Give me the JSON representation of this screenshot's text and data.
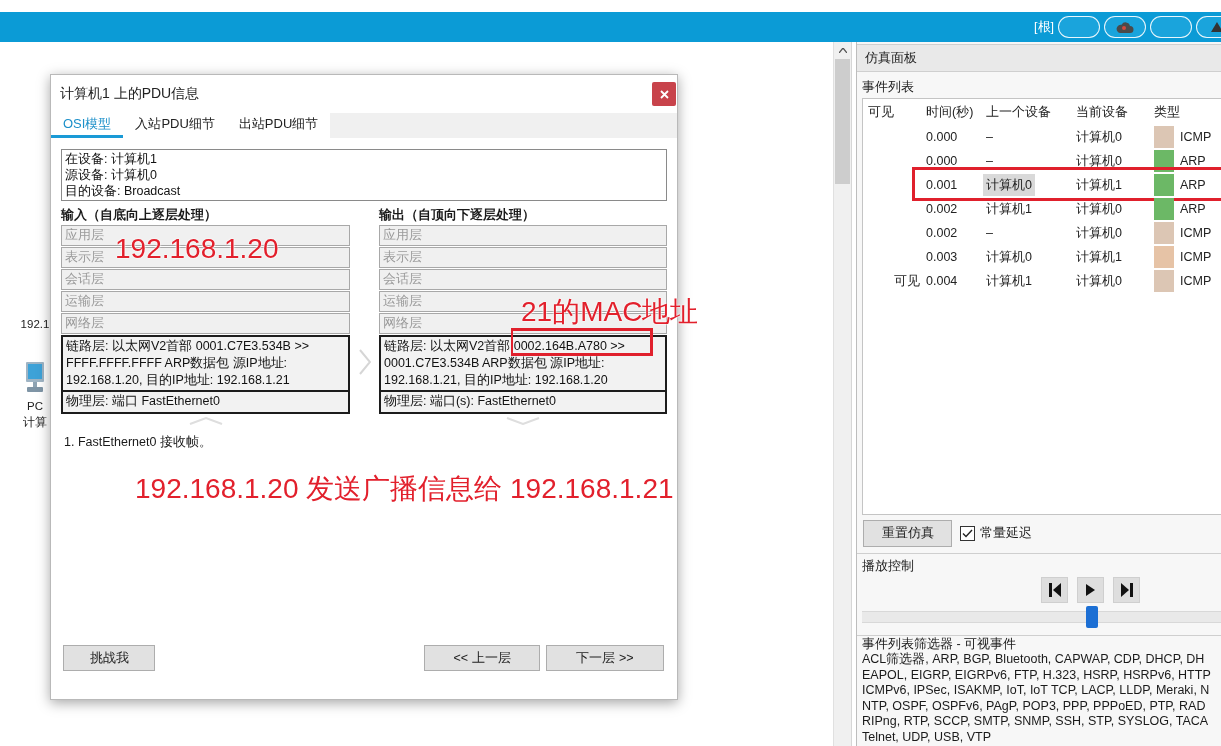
{
  "toolbar": {
    "root_label": "[根]",
    "buttons": [
      {
        "kind": "blank"
      },
      {
        "kind": "cloud"
      },
      {
        "kind": "blank"
      },
      {
        "kind": "triangle"
      }
    ]
  },
  "workspace": {
    "device": {
      "address": "192.1",
      "name": "PC",
      "label": "计算"
    }
  },
  "dialog": {
    "title": "计算机1 上的PDU信息",
    "tabs": [
      {
        "label": "OSI模型",
        "selected": true
      },
      {
        "label": "入站PDU细节",
        "selected": false
      },
      {
        "label": "出站PDU细节",
        "selected": false
      }
    ],
    "info_lines": [
      "在设备: 计算机1",
      "源设备: 计算机0",
      "目的设备: Broadcast"
    ],
    "input": {
      "heading": "输入（自底向上逐层处理）",
      "annotation": "192.168.1.20",
      "layers": [
        {
          "text": "应用层",
          "active": false,
          "marked": false
        },
        {
          "text": "表示层",
          "active": false,
          "marked": false
        },
        {
          "text": "会话层",
          "active": false,
          "marked": false
        },
        {
          "text": "运输层",
          "active": false,
          "marked": false
        },
        {
          "text": "网络层",
          "active": false,
          "marked": false
        },
        {
          "text": "链路层: 以太网V2首部 0001.C7E3.534B >> FFFF.FFFF.FFFF ARP数据包 源IP地址: 192.168.1.20, 目的IP地址: 192.168.1.21",
          "active": true,
          "marked": false
        },
        {
          "text": "物理层: 端口 FastEthernet0",
          "active": true,
          "marked": false
        }
      ]
    },
    "output": {
      "heading": "输出（自顶向下逐层处理）",
      "annotation": "21的MAC地址",
      "layers": [
        {
          "text": "应用层",
          "active": false,
          "marked": false
        },
        {
          "text": "表示层",
          "active": false,
          "marked": false
        },
        {
          "text": "会话层",
          "active": false,
          "marked": false
        },
        {
          "text": "运输层",
          "active": false,
          "marked": false
        },
        {
          "text": "网络层",
          "active": false,
          "marked": false
        },
        {
          "text": "链路层: 以太网V2首部 0002.164B.A780 >> 0001.C7E3.534B ARP数据包 源IP地址: 192.168.1.21, 目的IP地址: 192.168.1.20",
          "active": true,
          "marked": true
        },
        {
          "text": "物理层: 端口(s): FastEthernet0",
          "active": true,
          "marked": false
        }
      ]
    },
    "notes": [
      "1. FastEthernet0 接收帧。"
    ],
    "annotation": "192.168.1.20 发送广播信息给 192.168.1.21",
    "buttons": [
      {
        "kind": "challenge",
        "label": "挑战我"
      },
      {
        "kind": "prev",
        "label": "<< 上一层"
      },
      {
        "kind": "next",
        "label": "下一层 >>"
      }
    ]
  },
  "sim_panel": {
    "title": "仿真面板",
    "event_list": {
      "label": "事件列表",
      "columns": [
        "可见",
        "时间(秒)",
        "上一个设备",
        "当前设备",
        "类型"
      ],
      "rows": [
        {
          "time": "0.000",
          "previous": "–",
          "current": "计算机0",
          "type": "ICMP",
          "color": "#dcc6b4",
          "selected": false,
          "marked": false
        },
        {
          "time": "0.000",
          "previous": "–",
          "current": "计算机0",
          "type": "ARP",
          "color": "#6cb866",
          "selected": false,
          "marked": false
        },
        {
          "time": "0.001",
          "previous": "计算机0",
          "current": "计算机1",
          "type": "ARP",
          "color": "#6cb866",
          "selected": true,
          "marked": true
        },
        {
          "time": "0.002",
          "previous": "计算机1",
          "current": "计算机0",
          "type": "ARP",
          "color": "#6cb866",
          "selected": false,
          "marked": false
        },
        {
          "time": "0.002",
          "previous": "–",
          "current": "计算机0",
          "type": "ICMP",
          "color": "#dcc6b4",
          "selected": false,
          "marked": false
        },
        {
          "time": "0.003",
          "previous": "计算机0",
          "current": "计算机1",
          "type": "ICMP",
          "color": "#e6c3a6",
          "selected": false,
          "marked": false
        },
        {
          "visible_label": "可见",
          "time": "0.004",
          "previous": "计算机1",
          "current": "计算机0",
          "type": "ICMP",
          "color": "#dcc6b4",
          "selected": false,
          "marked": false
        }
      ]
    },
    "reset_button": "重置仿真",
    "constant_delay": {
      "label": "常量延迟",
      "checked": true
    },
    "playback": {
      "label": "播放控制",
      "buttons": [
        {
          "kind": "back"
        },
        {
          "kind": "play"
        },
        {
          "kind": "forward"
        }
      ],
      "slider": {
        "level": 0.64
      }
    },
    "filter": {
      "title": "事件列表筛选器 - 可视事件",
      "lines": [
        "ACL筛选器, ARP, BGP, Bluetooth, CAPWAP, CDP, DHCP, DH",
        "EAPOL, EIGRP, EIGRPv6, FTP, H.323, HSRP, HSRPv6, HTTP",
        "ICMPv6, IPSec, ISAKMP, IoT, IoT TCP, LACP, LLDP, Meraki, N",
        "NTP, OSPF, OSPFv6, PAgP, POP3, PPP, PPPoED, PTP, RAD",
        "RIPng, RTP, SCCP, SMTP, SNMP, SSH, STP, SYSLOG, TACA",
        "Telnet, UDP, USB, VTP"
      ]
    }
  }
}
